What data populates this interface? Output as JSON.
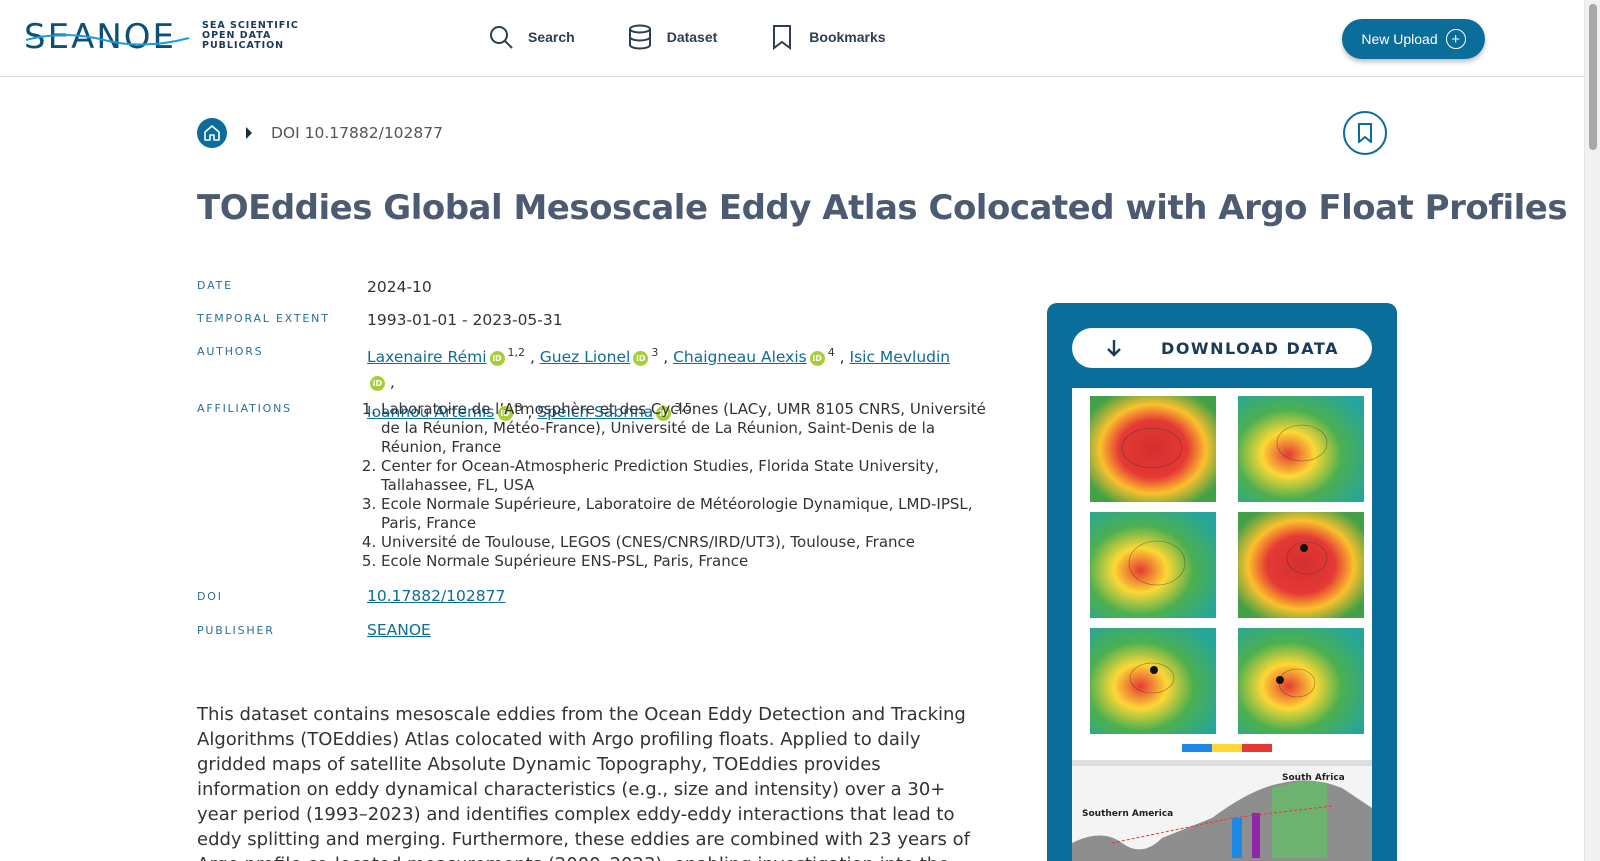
{
  "header": {
    "logo_text": "SEANOE",
    "logo_tagline": "SEA SCIENTIFIC OPEN DATA PUBLICATION",
    "nav": [
      {
        "label": "Search",
        "icon": "search-icon"
      },
      {
        "label": "Dataset",
        "icon": "database-icon"
      },
      {
        "label": "Bookmarks",
        "icon": "bookmark-icon"
      }
    ],
    "upload_label": "New Upload"
  },
  "breadcrumb": {
    "doi": "DOI 10.17882/102877"
  },
  "title": "TOEddies Global Mesoscale Eddy Atlas Colocated with Argo Float Profiles",
  "meta": {
    "date_label": "DATE",
    "date_value": "2024-10",
    "temporal_label": "TEMPORAL EXTENT",
    "temporal_value": "1993-01-01 - 2023-05-31",
    "authors_label": "AUTHORS",
    "authors": [
      {
        "name": "Laxenaire Rémi",
        "sup": "1,2"
      },
      {
        "name": "Guez Lionel",
        "sup": "3"
      },
      {
        "name": "Chaigneau Alexis",
        "sup": "4"
      },
      {
        "name": "Isic Mevludin",
        "sup": ""
      },
      {
        "name": "Ioannou Artemis",
        "sup": "3"
      },
      {
        "name": "Speich Sabrina",
        "sup": "3,5"
      }
    ],
    "affiliations_label": "AFFILIATIONS",
    "affiliations": [
      "Laboratoire de l’Atmosphère et des Cyclones (LACy, UMR 8105 CNRS, Université de la Réunion, Météo-France), Université de La Réunion, Saint-Denis de la Réunion, France",
      "Center for Ocean-Atmospheric Prediction Studies, Florida State University, Tallahassee, FL, USA",
      "Ecole Normale Supérieure, Laboratoire de Météorologie Dynamique, LMD-IPSL, Paris, France",
      "Université de Toulouse, LEGOS (CNES/CNRS/IRD/UT3), Toulouse, France",
      "Ecole Normale Supérieure ENS-PSL, Paris, France"
    ],
    "doi_label": "DOI",
    "doi_value": "10.17882/102877",
    "publisher_label": "PUBLISHER",
    "publisher_value": "SEANOE"
  },
  "description": "This dataset contains mesoscale eddies from the Ocean Eddy Detection and Tracking Algorithms (TOEddies) Atlas colocated with Argo profiling floats. Applied to daily gridded maps of satellite Absolute Dynamic Topography, TOEddies provides information on eddy dynamical characteristics (e.g., size and intensity) over a 30+ year period (1993–2023) and identifies complex eddy-eddy interactions that lead to eddy splitting and merging. Furthermore, these eddies are combined with 23 years of Argo profile co-located measurements (2000–2023), enabling investigation into the signature of eddies and their impact in the ocean interior. This",
  "download": {
    "label": "DOWNLOAD DATA",
    "thumb_labels": [
      "South Africa",
      "Southern America"
    ]
  },
  "colors": {
    "primary": "#0b6d99",
    "title": "#4d5b72",
    "orcid": "#a6ce39"
  }
}
